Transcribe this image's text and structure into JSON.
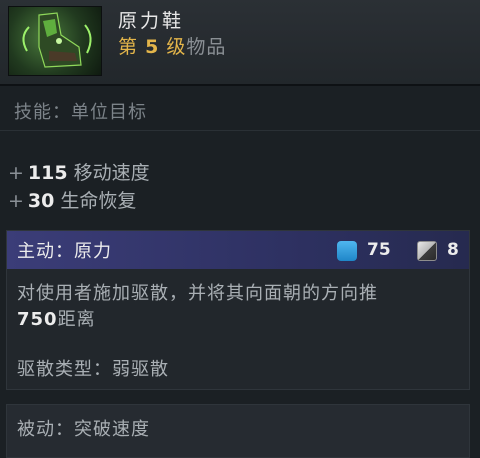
{
  "item": {
    "name": "原力鞋",
    "tier_prefix": "第",
    "tier_number": "5",
    "tier_suffix": "级",
    "tier_category": "物品",
    "icon": "force-boots-icon"
  },
  "behavior": "技能：单位目标",
  "stats": [
    {
      "sign": "+",
      "value": "115",
      "label": "移动速度"
    },
    {
      "sign": "+",
      "value": "30",
      "label": "生命恢复"
    }
  ],
  "active": {
    "title": "主动：原力",
    "mana_cost": "75",
    "cooldown": "8",
    "description_text": "对使用者施加驱散，并将其向面朝的方向推",
    "description_value": "750",
    "description_suffix": "距离",
    "dispel_type": "驱散类型：弱驱散"
  },
  "passive": {
    "title": "被动：突破速度"
  },
  "colors": {
    "tier_gold": "#e3b54a",
    "active_header": "#3b3d78",
    "mana": "#2f9fe0"
  }
}
